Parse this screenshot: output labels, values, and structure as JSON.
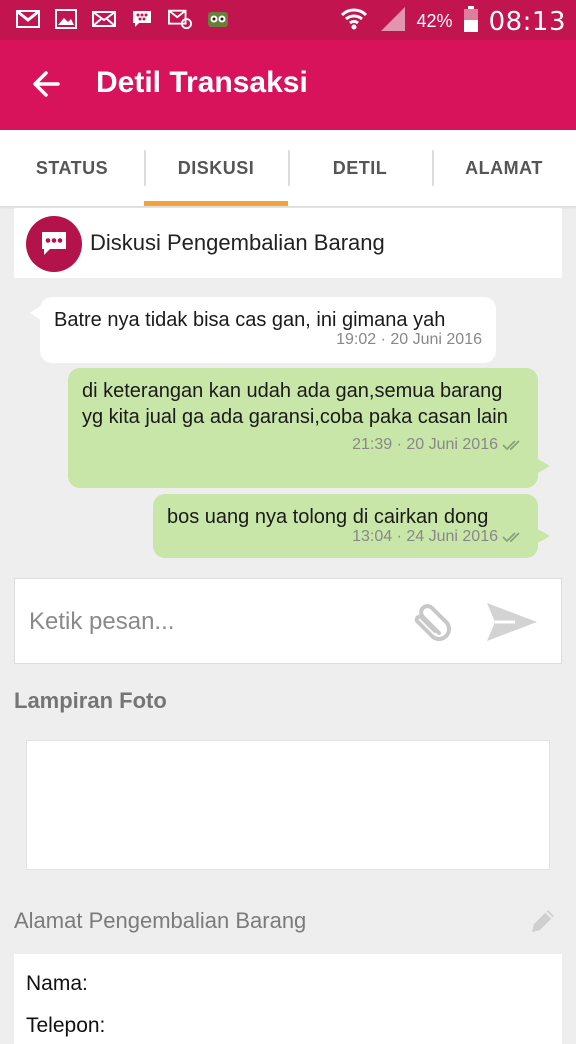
{
  "status_bar": {
    "left_icons": [
      "gmail-icon",
      "image-icon",
      "mail-icon",
      "bbm-icon",
      "email-icon",
      "owl-app-icon"
    ],
    "battery_percent": "42%",
    "time": "08:13"
  },
  "app_bar": {
    "title": "Detil Transaksi"
  },
  "tabs": [
    {
      "label": "STATUS",
      "active": false
    },
    {
      "label": "DISKUSI",
      "active": true
    },
    {
      "label": "DETIL",
      "active": false
    },
    {
      "label": "ALAMAT",
      "active": false
    }
  ],
  "discussion": {
    "title": "Diskusi Pengembalian Barang",
    "messages": [
      {
        "direction": "incoming",
        "text": "Batre nya tidak bisa cas gan, ini gimana yah",
        "time": "19:02 · 20 Juni 2016"
      },
      {
        "direction": "outgoing",
        "text": "di keterangan kan udah ada gan,semua barang yg kita jual ga ada garansi,coba paka casan lain",
        "time": "21:39 · 20 Juni 2016"
      },
      {
        "direction": "outgoing",
        "text": "bos uang nya tolong di cairkan dong",
        "time": "13:04 · 24 Juni 2016"
      }
    ]
  },
  "composer": {
    "placeholder": "Ketik pesan..."
  },
  "attachments": {
    "label": "Lampiran Foto"
  },
  "return_address": {
    "label": "Alamat Pengembalian Barang",
    "name_label": "Nama:",
    "phone_label": "Telepon:"
  },
  "colors": {
    "status_bar": "#c2144e",
    "app_bar": "#d8125b",
    "tab_indicator": "#f1a33a",
    "outgoing_bubble": "#c8e6a8",
    "discussion_icon": "#b3134a"
  }
}
